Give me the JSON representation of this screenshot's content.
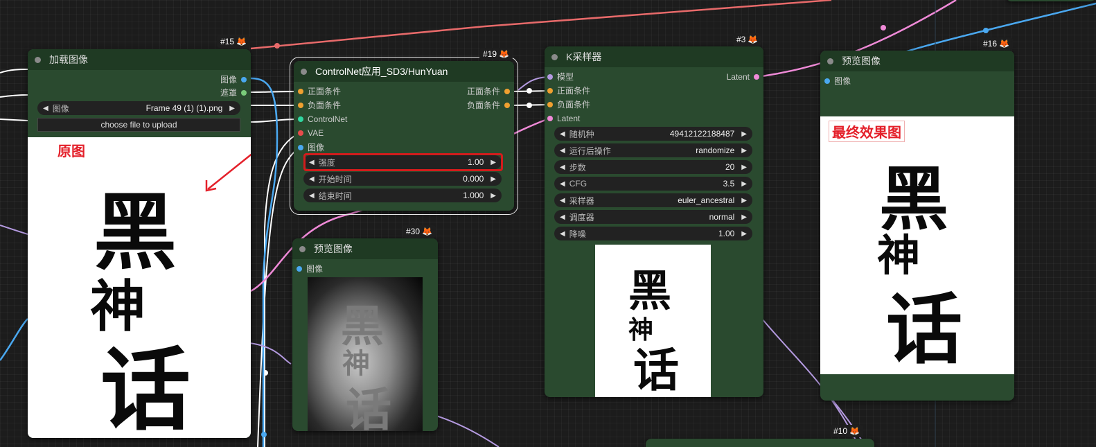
{
  "colors": {
    "node_bg": "#2a4a2f",
    "node_title_bg": "#1f3a23",
    "image_slot": "#4aa8f0",
    "mask_slot": "#7acb7a",
    "conditioning_slot": "#f0a030",
    "controlnet_slot": "#30d6a0",
    "vae_slot": "#e84c4c",
    "model_slot": "#b49ae0",
    "latent_slot": "#f08ad8",
    "annotation_red": "#e4202a"
  },
  "nodes": {
    "load_image": {
      "badge": "#15",
      "title": "加载图像",
      "outputs": [
        "图像",
        "遮罩"
      ],
      "image_widget": {
        "label": "图像",
        "value": "Frame 49 (1) (1).png"
      },
      "upload_button": "choose file to upload",
      "annotation": "原图",
      "preview_text": [
        "黑",
        "神",
        "话"
      ]
    },
    "controlnet": {
      "badge": "#19",
      "title": "ControlNet应用_SD3/HunYuan",
      "inputs": [
        "正面条件",
        "负面条件",
        "ControlNet",
        "VAE",
        "图像"
      ],
      "outputs": [
        "正面条件",
        "负面条件"
      ],
      "widgets": [
        {
          "label": "强度",
          "value": "1.00"
        },
        {
          "label": "开始时间",
          "value": "0.000"
        },
        {
          "label": "结束时间",
          "value": "1.000"
        }
      ]
    },
    "preview_30": {
      "badge": "#30",
      "title": "预览图像",
      "input": "图像",
      "preview_text": [
        "黑",
        "神",
        "话"
      ]
    },
    "ksampler": {
      "badge": "#3",
      "title": "K采样器",
      "inputs": [
        "模型",
        "正面条件",
        "负面条件",
        "Latent"
      ],
      "output": "Latent",
      "widgets": [
        {
          "label": "随机种",
          "value": "49412122188487"
        },
        {
          "label": "运行后操作",
          "value": "randomize"
        },
        {
          "label": "步数",
          "value": "20"
        },
        {
          "label": "CFG",
          "value": "3.5"
        },
        {
          "label": "采样器",
          "value": "euler_ancestral"
        },
        {
          "label": "调度器",
          "value": "normal"
        },
        {
          "label": "降噪",
          "value": "1.00"
        }
      ],
      "preview_text": [
        "黑",
        "神",
        "话"
      ]
    },
    "preview_16": {
      "badge": "#16",
      "title": "预览图像",
      "input": "图像",
      "annotation": "最终效果图",
      "preview_text": [
        "黑",
        "神",
        "话"
      ]
    },
    "partial_10": {
      "badge": "#10"
    }
  }
}
